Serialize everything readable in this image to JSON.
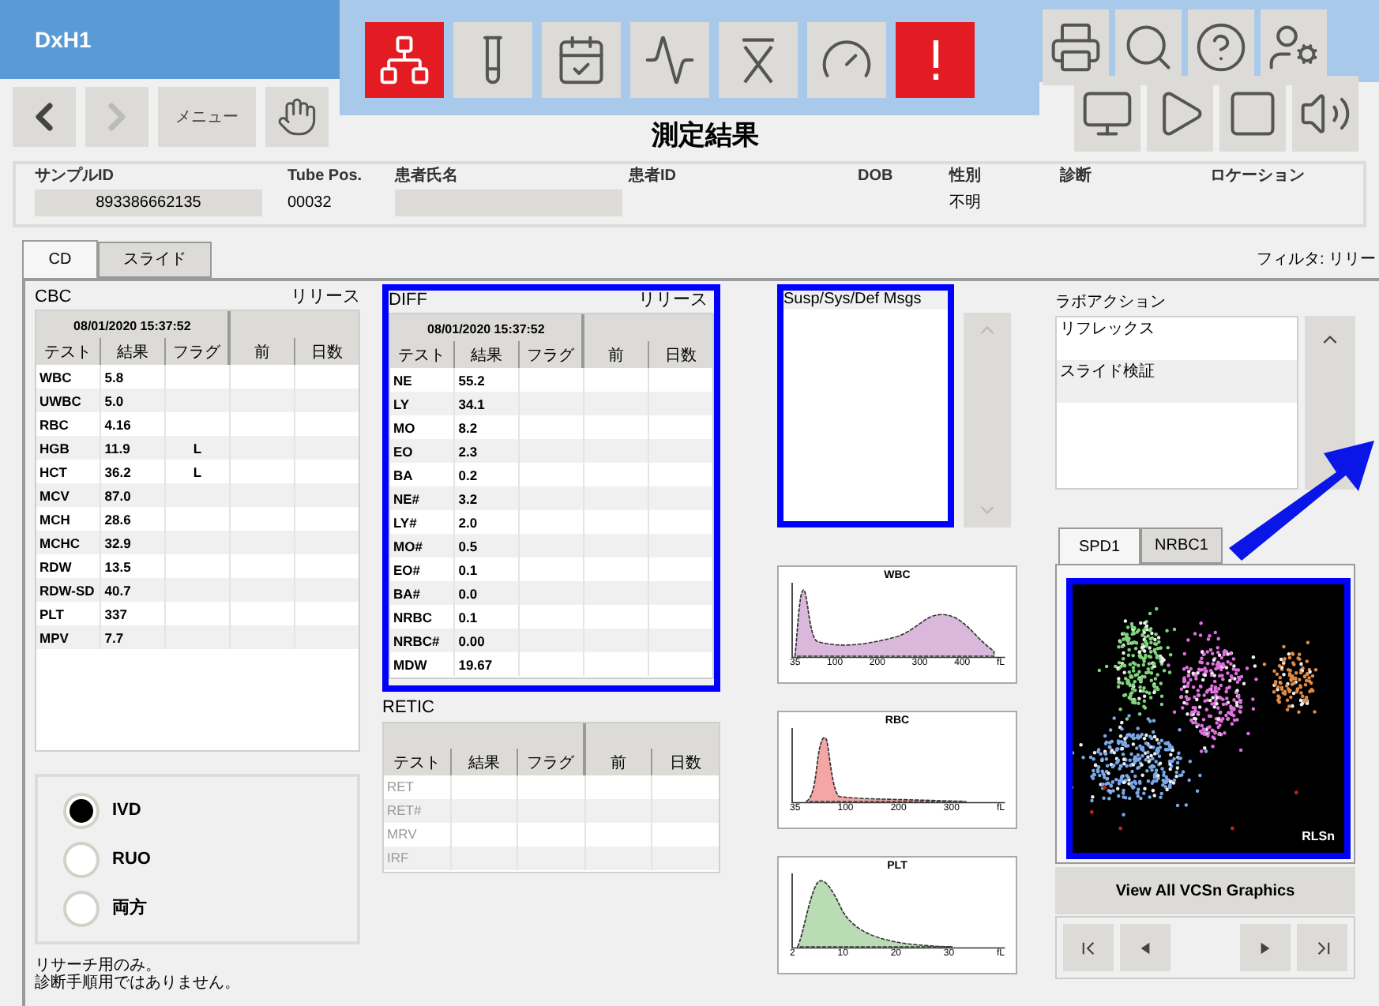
{
  "header": {
    "app_name": "DxH1",
    "back": {
      "disabled": false
    },
    "forward": {
      "disabled": true
    },
    "menu_button": "メニュー",
    "title": "測定結果",
    "toolbar": [
      {
        "kind": "network",
        "highlighted": true
      },
      {
        "kind": "tube",
        "highlighted": false
      },
      {
        "kind": "calendar",
        "highlighted": false
      },
      {
        "kind": "graph",
        "highlighted": false
      },
      {
        "kind": "xbar",
        "highlighted": false
      },
      {
        "kind": "gauge",
        "highlighted": false
      },
      {
        "kind": "alert",
        "highlighted": true
      }
    ],
    "tools_top": [
      {
        "kind": "printer"
      },
      {
        "kind": "search"
      },
      {
        "kind": "help"
      },
      {
        "kind": "user"
      }
    ],
    "tools_bottom": [
      {
        "kind": "monitor"
      },
      {
        "kind": "play"
      },
      {
        "kind": "stop"
      },
      {
        "kind": "sound"
      }
    ]
  },
  "sample_info": [
    {
      "label": "サンプルID",
      "value": "893386662135",
      "kind": "boxed"
    },
    {
      "label": "Tube Pos.",
      "value": "00032",
      "kind": "plain"
    },
    {
      "label": "患者氏名",
      "kind": "boxed"
    },
    {
      "label": "患者ID",
      "kind": "plain"
    },
    {
      "label": "DOB",
      "kind": "plain"
    },
    {
      "label": "性別",
      "value": "不明",
      "kind": "plain"
    },
    {
      "label": "診断",
      "kind": "plain"
    },
    {
      "label": "ロケーション",
      "kind": "plain"
    }
  ],
  "tabs": [
    {
      "label": "CD",
      "selected": true
    },
    {
      "label": "スライド",
      "selected": false
    }
  ],
  "filter": "フィルタ: リリー",
  "cbc": {
    "title": "CBC",
    "status": "リリース",
    "timestamp": "08/01/2020 15:37:52",
    "columns": [
      "テスト",
      "結果",
      "フラグ",
      "前",
      "日数"
    ],
    "rows": [
      {
        "test": "WBC",
        "result": "5.8"
      },
      {
        "test": "UWBC",
        "result": "5.0"
      },
      {
        "test": "RBC",
        "result": "4.16"
      },
      {
        "test": "HGB",
        "result": "11.9",
        "flag": "L"
      },
      {
        "test": "HCT",
        "result": "36.2",
        "flag": "L"
      },
      {
        "test": "MCV",
        "result": "87.0"
      },
      {
        "test": "MCH",
        "result": "28.6"
      },
      {
        "test": "MCHC",
        "result": "32.9"
      },
      {
        "test": "RDW",
        "result": "13.5"
      },
      {
        "test": "RDW-SD",
        "result": "40.7"
      },
      {
        "test": "PLT",
        "result": "337"
      },
      {
        "test": "MPV",
        "result": "7.7"
      }
    ]
  },
  "diff": {
    "title": "DIFF",
    "status": "リリース",
    "timestamp": "08/01/2020 15:37:52",
    "columns": [
      "テスト",
      "結果",
      "フラグ",
      "前",
      "日数"
    ],
    "rows": [
      {
        "test": "NE",
        "result": "55.2"
      },
      {
        "test": "LY",
        "result": "34.1"
      },
      {
        "test": "MO",
        "result": "8.2"
      },
      {
        "test": "EO",
        "result": "2.3"
      },
      {
        "test": "BA",
        "result": "0.2"
      },
      {
        "test": "NE#",
        "result": "3.2"
      },
      {
        "test": "LY#",
        "result": "2.0"
      },
      {
        "test": "MO#",
        "result": "0.5"
      },
      {
        "test": "EO#",
        "result": "0.1"
      },
      {
        "test": "BA#",
        "result": "0.0"
      },
      {
        "test": "NRBC",
        "result": "0.1"
      },
      {
        "test": "NRBC#",
        "result": "0.00"
      },
      {
        "test": "MDW",
        "result": "19.67"
      }
    ]
  },
  "retic": {
    "title": "RETIC",
    "columns": [
      "テスト",
      "結果",
      "フラグ",
      "前",
      "日数"
    ],
    "rows": [
      {
        "test": "RET",
        "disabled": true
      },
      {
        "test": "RET#",
        "disabled": true
      },
      {
        "test": "MRV",
        "disabled": true
      },
      {
        "test": "IRF",
        "disabled": true
      }
    ]
  },
  "messages": {
    "title": "Susp/Sys/Def Msgs"
  },
  "histograms": [
    {
      "title": "WBC",
      "kind": "wbc",
      "color": "#d9b8dc",
      "x_labels": [
        "35",
        "100",
        "200",
        "300",
        "400",
        "fL"
      ]
    },
    {
      "title": "RBC",
      "kind": "rbc",
      "color": "#f4a6a6",
      "x_labels": [
        "35",
        "100",
        "200",
        "300",
        "fL"
      ]
    },
    {
      "title": "PLT",
      "kind": "plt",
      "color": "#b9dcb4",
      "x_labels": [
        "2",
        "10",
        "20",
        "30",
        "fL"
      ]
    }
  ],
  "lab_actions": {
    "title": "ラボアクション",
    "items": [
      "リフレックス",
      "スライド検証"
    ]
  },
  "scatter": {
    "tabs": [
      {
        "label": "SPD1",
        "selected": true
      },
      {
        "label": "NRBC1",
        "selected": false
      }
    ],
    "corner_label": "RLSn"
  },
  "view_all_button": "View All VCSn Graphics",
  "mode": {
    "options": [
      {
        "label": "IVD",
        "selected": true
      },
      {
        "label": "RUO",
        "selected": false
      },
      {
        "label": "両方",
        "selected": false
      }
    ]
  },
  "footnote": [
    "リサーチ用のみ。",
    "診断手順用ではありません。"
  ]
}
